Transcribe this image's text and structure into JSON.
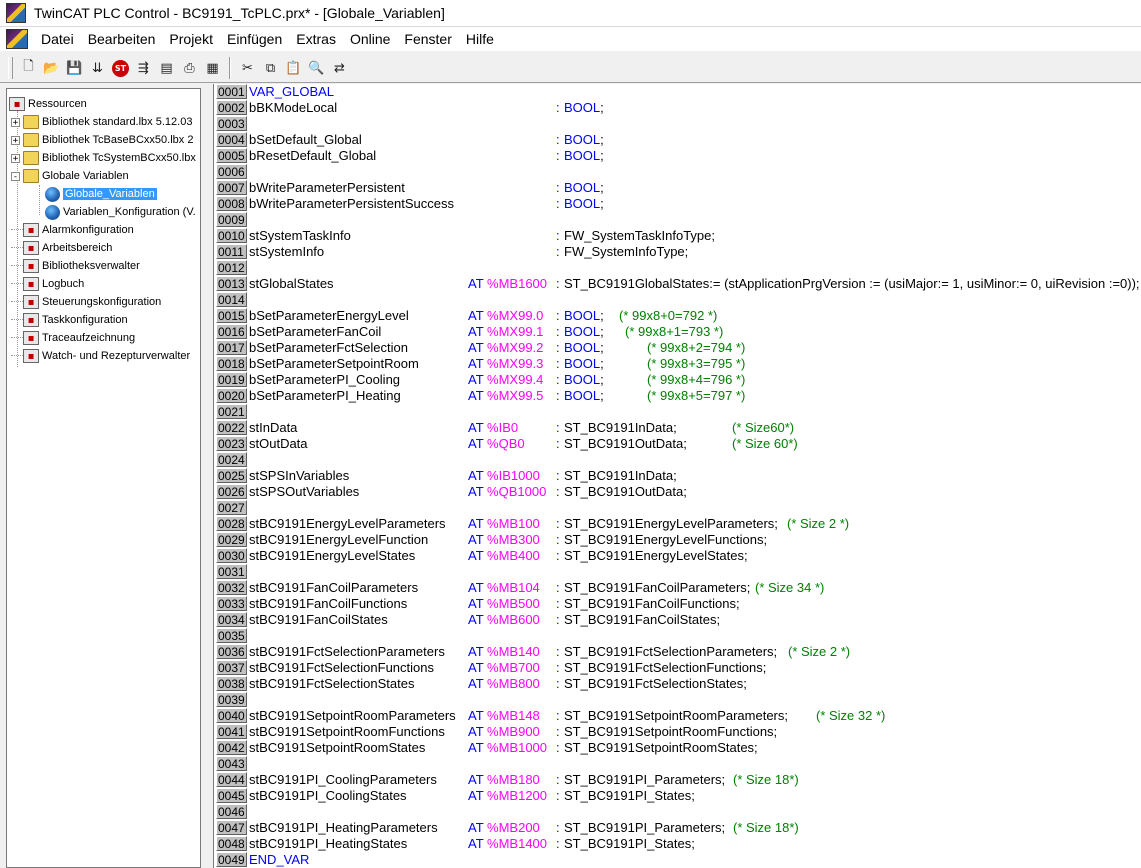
{
  "window": {
    "title": "TwinCAT PLC Control - BC9191_TcPLC.prx* - [Globale_Variablen]"
  },
  "menu": [
    "Datei",
    "Bearbeiten",
    "Projekt",
    "Einfügen",
    "Extras",
    "Online",
    "Fenster",
    "Hilfe"
  ],
  "toolbar": {
    "group1": [
      {
        "name": "new-file-icon",
        "glyph": "🗋"
      },
      {
        "name": "open-folder-icon",
        "glyph": "📂"
      },
      {
        "name": "save-icon",
        "glyph": "💾"
      },
      {
        "name": "build-icon",
        "glyph": "⇊"
      },
      {
        "name": "stop-icon",
        "glyph": "ST"
      },
      {
        "name": "step-icon",
        "glyph": "⇶"
      },
      {
        "name": "breakpoint-icon",
        "glyph": "▤"
      },
      {
        "name": "print-icon",
        "glyph": "⎙"
      },
      {
        "name": "download-icon",
        "glyph": "▦"
      }
    ],
    "group2": [
      {
        "name": "cut-icon",
        "glyph": "✂"
      },
      {
        "name": "copy-icon",
        "glyph": "⧉"
      },
      {
        "name": "paste-icon",
        "glyph": "📋"
      },
      {
        "name": "find-icon",
        "glyph": "🔍"
      },
      {
        "name": "replace-icon",
        "glyph": "⇄"
      }
    ]
  },
  "tree": [
    {
      "label": "Ressourcen",
      "level": 0,
      "expander": "",
      "icon": "generic",
      "selected": false
    },
    {
      "label": "Bibliothek standard.lbx 5.12.03",
      "level": 1,
      "expander": "+",
      "icon": "folder",
      "selected": false
    },
    {
      "label": "Bibliothek TcBaseBCxx50.lbx 2",
      "level": 1,
      "expander": "+",
      "icon": "folder",
      "selected": false
    },
    {
      "label": "Bibliothek TcSystemBCxx50.lbx",
      "level": 1,
      "expander": "+",
      "icon": "folder",
      "selected": false
    },
    {
      "label": "Globale Variablen",
      "level": 1,
      "expander": "−",
      "icon": "folder",
      "selected": false
    },
    {
      "label": "Globale_Variablen",
      "level": 2,
      "expander": "",
      "icon": "globe",
      "selected": true
    },
    {
      "label": "Variablen_Konfiguration (V.",
      "level": 2,
      "expander": "",
      "icon": "globe",
      "selected": false
    },
    {
      "label": "Alarmkonfiguration",
      "level": 1,
      "expander": "",
      "icon": "generic",
      "selected": false
    },
    {
      "label": "Arbeitsbereich",
      "level": 1,
      "expander": "",
      "icon": "generic",
      "selected": false
    },
    {
      "label": "Bibliotheksverwalter",
      "level": 1,
      "expander": "",
      "icon": "generic",
      "selected": false
    },
    {
      "label": "Logbuch",
      "level": 1,
      "expander": "",
      "icon": "generic",
      "selected": false
    },
    {
      "label": "Steuerungskonfiguration",
      "level": 1,
      "expander": "",
      "icon": "generic",
      "selected": false
    },
    {
      "label": "Taskkonfiguration",
      "level": 1,
      "expander": "",
      "icon": "generic",
      "selected": false
    },
    {
      "label": "Traceaufzeichnung",
      "level": 1,
      "expander": "",
      "icon": "generic",
      "selected": false
    },
    {
      "label": "Watch- und Rezepturverwalter",
      "level": 1,
      "expander": "",
      "icon": "generic",
      "selected": false
    }
  ],
  "code": [
    {
      "no": "0001",
      "kw": "VAR_GLOBAL"
    },
    {
      "no": "0002",
      "name": "bBKModeLocal",
      "type": "BOOL",
      "typeKw": true
    },
    {
      "no": "0003"
    },
    {
      "no": "0004",
      "name": "bSetDefault_Global",
      "type": "BOOL",
      "typeKw": true
    },
    {
      "no": "0005",
      "name": "bResetDefault_Global",
      "type": "BOOL",
      "typeKw": true
    },
    {
      "no": "0006"
    },
    {
      "no": "0007",
      "name": "bWriteParameterPersistent",
      "type": "BOOL",
      "typeKw": true
    },
    {
      "no": "0008",
      "name": "bWriteParameterPersistentSuccess",
      "type": "BOOL",
      "typeKw": true
    },
    {
      "no": "0009"
    },
    {
      "no": "0010",
      "name": "stSystemTaskInfo",
      "type": "FW_SystemTaskInfoType;"
    },
    {
      "no": "0011",
      "name": "stSystemInfo",
      "type": "FW_SystemInfoType;"
    },
    {
      "no": "0012"
    },
    {
      "no": "0013",
      "name": "stGlobalStates",
      "addr": "%MB1600",
      "type": "ST_BC9191GlobalStates:= (stApplicationPrgVersion := (usiMajor:= 1, usiMinor:= 0, uiRevision :=0));"
    },
    {
      "no": "0014"
    },
    {
      "no": "0015",
      "name": "bSetParameterEnergyLevel",
      "addr": "%MX99.0",
      "type": "BOOL",
      "typeKw": true,
      "comment": "(* 99x8+0=792 *)",
      "cpos": 405
    },
    {
      "no": "0016",
      "name": "bSetParameterFanCoil",
      "addr": "%MX99.1",
      "type": "BOOL",
      "typeKw": true,
      "comment": "(* 99x8+1=793 *)",
      "cpos": 411
    },
    {
      "no": "0017",
      "name": "bSetParameterFctSelection",
      "addr": "%MX99.2",
      "type": "BOOL",
      "typeKw": true,
      "comment": "(* 99x8+2=794 *)",
      "cpos": 433
    },
    {
      "no": "0018",
      "name": "bSetParameterSetpointRoom",
      "addr": "%MX99.3",
      "type": "BOOL",
      "typeKw": true,
      "comment": "(* 99x8+3=795 *)",
      "cpos": 433
    },
    {
      "no": "0019",
      "name": "bSetParameterPI_Cooling",
      "addr": "%MX99.4",
      "type": "BOOL",
      "typeKw": true,
      "comment": "(* 99x8+4=796 *)",
      "cpos": 433
    },
    {
      "no": "0020",
      "name": "bSetParameterPI_Heating",
      "addr": "%MX99.5",
      "type": "BOOL",
      "typeKw": true,
      "comment": "(* 99x8+5=797 *)",
      "cpos": 433
    },
    {
      "no": "0021"
    },
    {
      "no": "0022",
      "name": "stInData",
      "addr": "%IB0",
      "type": "ST_BC9191InData;",
      "comment": "(* Size60*)",
      "cpos": 518
    },
    {
      "no": "0023",
      "name": "stOutData",
      "addr": "%QB0",
      "type": "ST_BC9191OutData;",
      "comment": "(* Size 60*)",
      "cpos": 518
    },
    {
      "no": "0024"
    },
    {
      "no": "0025",
      "name": "stSPSInVariables",
      "addr": "%IB1000",
      "type": "ST_BC9191InData;"
    },
    {
      "no": "0026",
      "name": "stSPSOutVariables",
      "addr": "%QB1000",
      "type": "ST_BC9191OutData;"
    },
    {
      "no": "0027"
    },
    {
      "no": "0028",
      "name": "stBC9191EnergyLevelParameters",
      "addr": "%MB100",
      "type": "ST_BC9191EnergyLevelParameters;",
      "comment": "(* Size 2 *)",
      "cpos": 573
    },
    {
      "no": "0029",
      "name": "stBC9191EnergyLevelFunction",
      "addr": "%MB300",
      "type": "ST_BC9191EnergyLevelFunctions;"
    },
    {
      "no": "0030",
      "name": "stBC9191EnergyLevelStates",
      "addr": "%MB400",
      "type": "ST_BC9191EnergyLevelStates;"
    },
    {
      "no": "0031"
    },
    {
      "no": "0032",
      "name": "stBC9191FanCoilParameters",
      "addr": "%MB104",
      "type": "ST_BC9191FanCoilParameters;",
      "comment": "(* Size 34 *)",
      "cpos": 541
    },
    {
      "no": "0033",
      "name": "stBC9191FanCoilFunctions",
      "addr": "%MB500",
      "type": "ST_BC9191FanCoilFunctions;"
    },
    {
      "no": "0034",
      "name": "stBC9191FanCoilStates",
      "addr": "%MB600",
      "type": "ST_BC9191FanCoilStates;"
    },
    {
      "no": "0035"
    },
    {
      "no": "0036",
      "name": "stBC9191FctSelectionParameters",
      "addr": "%MB140",
      "type": "ST_BC9191FctSelectionParameters;",
      "comment": "(* Size 2 *)",
      "cpos": 574
    },
    {
      "no": "0037",
      "name": "stBC9191FctSelectionFunctions",
      "addr": "%MB700",
      "type": "ST_BC9191FctSelectionFunctions;"
    },
    {
      "no": "0038",
      "name": "stBC9191FctSelectionStates",
      "addr": "%MB800",
      "type": "ST_BC9191FctSelectionStates;"
    },
    {
      "no": "0039"
    },
    {
      "no": "0040",
      "name": "stBC9191SetpointRoomParameters",
      "addr": "%MB148",
      "type": "ST_BC9191SetpointRoomParameters;",
      "comment": "(* Size 32 *)",
      "cpos": 602
    },
    {
      "no": "0041",
      "name": "stBC9191SetpointRoomFunctions",
      "addr": "%MB900",
      "type": "ST_BC9191SetpointRoomFunctions;"
    },
    {
      "no": "0042",
      "name": "stBC9191SetpointRoomStates",
      "addr": "%MB1000",
      "type": "ST_BC9191SetpointRoomStates;"
    },
    {
      "no": "0043"
    },
    {
      "no": "0044",
      "name": "stBC9191PI_CoolingParameters",
      "addr": "%MB180",
      "type": "ST_BC9191PI_Parameters;",
      "comment": "(* Size 18*)",
      "cpos": 519
    },
    {
      "no": "0045",
      "name": "stBC9191PI_CoolingStates",
      "addr": "%MB1200",
      "type": "ST_BC9191PI_States;"
    },
    {
      "no": "0046"
    },
    {
      "no": "0047",
      "name": "stBC9191PI_HeatingParameters",
      "addr": "%MB200",
      "type": "ST_BC9191PI_Parameters;",
      "comment": "(* Size 18*)",
      "cpos": 519
    },
    {
      "no": "0048",
      "name": "stBC9191PI_HeatingStates",
      "addr": "%MB1400",
      "type": "ST_BC9191PI_States;"
    },
    {
      "no": "0049",
      "kw": "END_VAR"
    }
  ],
  "labels": {
    "at": "AT",
    "colon": ":",
    "semi": ";"
  }
}
